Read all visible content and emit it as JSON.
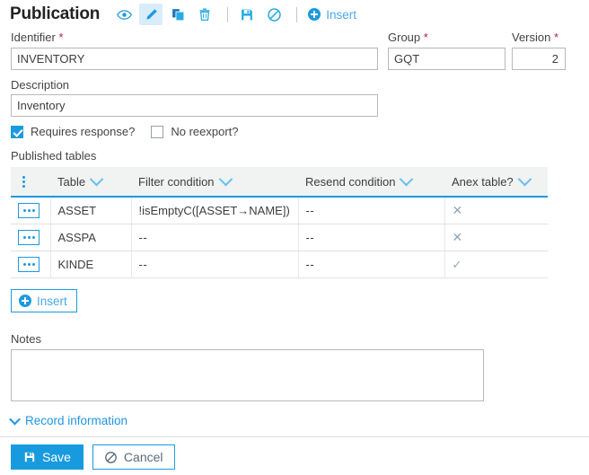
{
  "header": {
    "title": "Publication",
    "tools": [
      {
        "name": "view-icon",
        "label": "View",
        "active": false
      },
      {
        "name": "edit-icon",
        "label": "Edit",
        "active": true
      },
      {
        "name": "copy-icon",
        "label": "Copy",
        "active": false
      },
      {
        "name": "delete-icon",
        "label": "Delete",
        "active": false
      },
      {
        "name": "save-icon",
        "label": "Save",
        "active": false
      },
      {
        "name": "cancel-icon",
        "label": "Cancel",
        "active": false
      }
    ],
    "insert_label": "Insert"
  },
  "form": {
    "identifier_label": "Identifier",
    "identifier_value": "INVENTORY",
    "group_label": "Group",
    "group_value": "GQT",
    "version_label": "Version",
    "version_value": "2",
    "description_label": "Description",
    "description_value": "Inventory",
    "required_marker": "*",
    "requires_response_label": "Requires response?",
    "requires_response_checked": true,
    "no_reexport_label": "No reexport?",
    "no_reexport_checked": false
  },
  "published_tables": {
    "section_label": "Published tables",
    "columns": [
      {
        "label": "Table"
      },
      {
        "label": "Filter condition"
      },
      {
        "label": "Resend condition"
      },
      {
        "label": "Anex table?"
      }
    ],
    "rows": [
      {
        "table": "ASSET",
        "filter_condition": "!isEmptyC([ASSET→NAME])",
        "resend_condition": "--",
        "anex_table": "✕"
      },
      {
        "table": "ASSPA",
        "filter_condition": "--",
        "resend_condition": "--",
        "anex_table": "✕"
      },
      {
        "table": "KINDE",
        "filter_condition": "--",
        "resend_condition": "--",
        "anex_table": "✓"
      }
    ],
    "insert_label": "Insert"
  },
  "notes": {
    "label": "Notes",
    "value": ""
  },
  "record_information_label": "Record information",
  "footer": {
    "save_label": "Save",
    "cancel_label": "Cancel"
  },
  "colors": {
    "accent": "#1b9ae0",
    "link": "#2196e3",
    "required": "#b5213a",
    "header_bg": "#f1f2f2",
    "mark": "#93a6b5"
  }
}
